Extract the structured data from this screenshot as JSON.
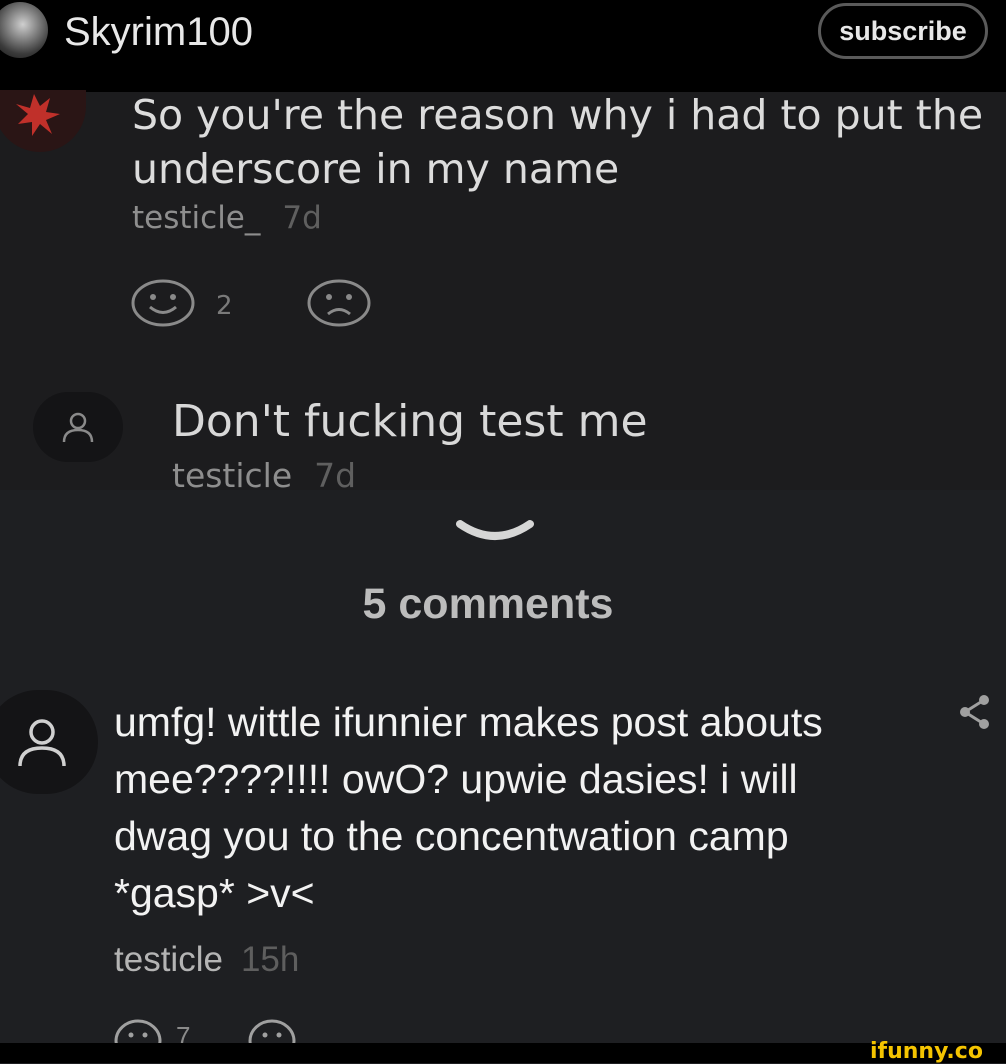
{
  "header": {
    "channel_name": "Skyrim100",
    "subscribe_label": "subscribe"
  },
  "comments_top": [
    {
      "text": "So you're the reason why i had to put the underscore in my name",
      "user": "testicle_",
      "time": "7d",
      "likes": "2"
    },
    {
      "text": "Don't fucking test me",
      "user": "testicle",
      "time": "7d"
    }
  ],
  "comments_section": {
    "count_label": "5 comments",
    "comments": [
      {
        "text": "umfg! wittle ifunnier makes post abouts mee????!!!! owO? upwie dasies! i will dwag you to the concentwation camp *gasp* >v<",
        "user": "testicle",
        "time": "15h",
        "likes": "7"
      }
    ]
  },
  "watermark": "ifunny.co",
  "colors": {
    "background": "#1e1f22",
    "header": "#000000",
    "accent_watermark": "#f5c400"
  },
  "icons": [
    "smile-icon",
    "frown-icon",
    "user-icon",
    "chevron-down-icon",
    "share-icon"
  ]
}
